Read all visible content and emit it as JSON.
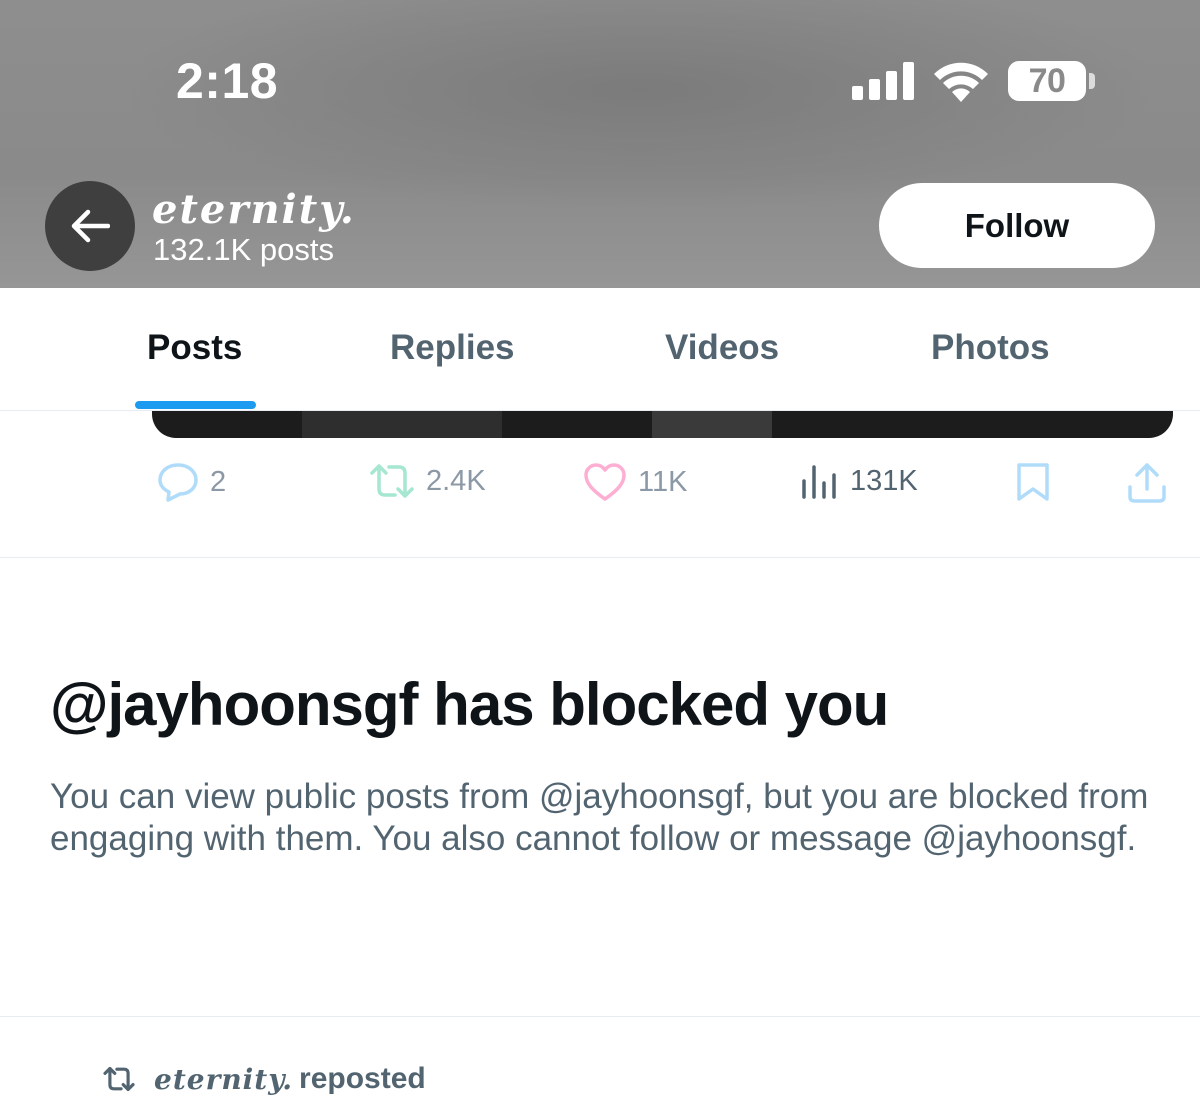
{
  "status_bar": {
    "time": "2:18",
    "battery": "70"
  },
  "header": {
    "account_name": "eternity.",
    "post_count": "132.1K posts",
    "follow_label": "Follow",
    "background_color": "#8d8d8d"
  },
  "tabs": [
    {
      "label": "Posts",
      "active": true
    },
    {
      "label": "Replies",
      "active": false
    },
    {
      "label": "Videos",
      "active": false
    },
    {
      "label": "Photos",
      "active": false
    }
  ],
  "accent_color": "#1d9bf0",
  "post_actions": {
    "replies": "2",
    "reposts": "2.4K",
    "likes": "11K",
    "views": "131K",
    "icons": [
      "reply-icon",
      "repost-icon",
      "like-icon",
      "views-icon",
      "bookmark-icon",
      "share-icon"
    ]
  },
  "blocked_notice": {
    "title": "@jayhoonsgf has blocked you",
    "body": "You can view public posts from @jayhoonsgf, but you are blocked from engaging with them. You also cannot follow or message @jayhoonsgf."
  },
  "repost_line": {
    "name": "eternity.",
    "label": "reposted"
  }
}
